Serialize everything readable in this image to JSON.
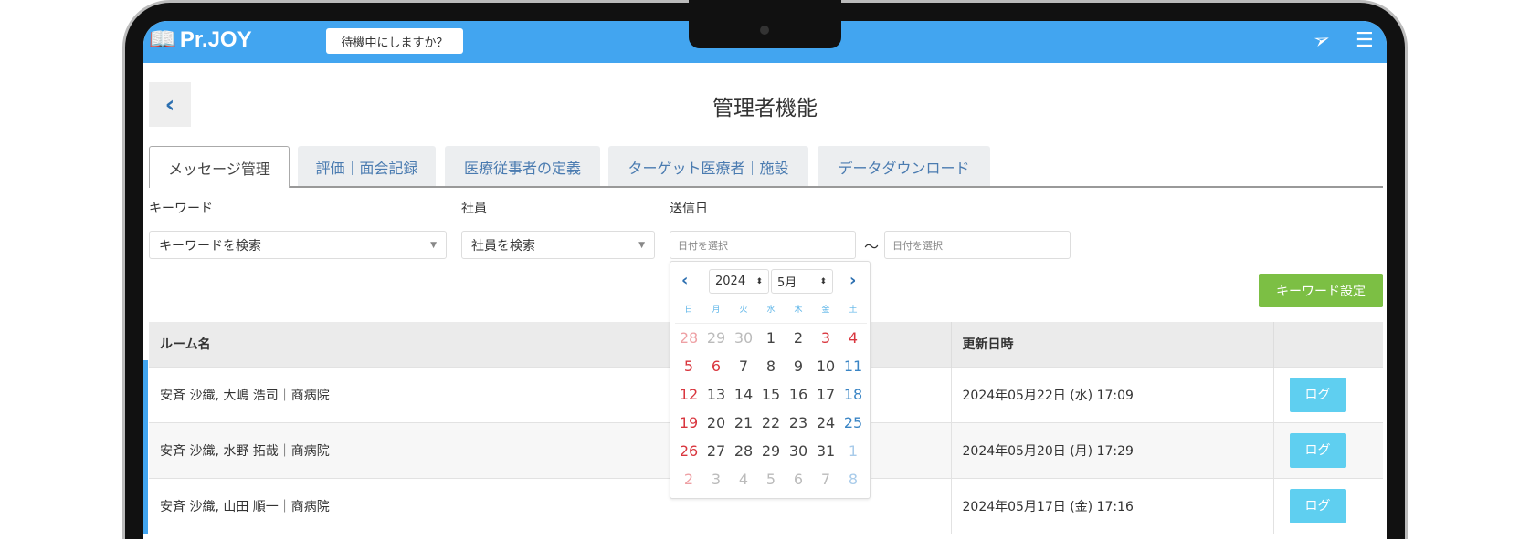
{
  "header": {
    "logo": "Pr.JOY",
    "standby_button": "待機中にしますか？",
    "icons": [
      "send-icon",
      "menu-icon"
    ]
  },
  "page": {
    "title": "管理者機能",
    "back": "back-chevron-icon"
  },
  "tabs": [
    {
      "label": "メッセージ管理",
      "active": true
    },
    {
      "label": "評価｜面会記録"
    },
    {
      "label": "医療従事者の定義"
    },
    {
      "label": "ターゲット医療者｜施設"
    },
    {
      "label": "データダウンロード"
    }
  ],
  "filters": {
    "keyword_label": "キーワード",
    "keyword_placeholder": "キーワードを検索",
    "employee_label": "社員",
    "employee_placeholder": "社員を検索",
    "date_label": "送信日",
    "date_from_placeholder": "日付を選択",
    "tilde": "〜",
    "date_to_placeholder": "日付を選択"
  },
  "keyword_settings_button": "キーワード設定",
  "calendar": {
    "year": "2024",
    "month": "5月",
    "weekdays": [
      "日",
      "月",
      "火",
      "水",
      "木",
      "金",
      "土"
    ],
    "weeks": [
      [
        "28",
        "29",
        "30",
        "1",
        "2",
        "3",
        "4"
      ],
      [
        "5",
        "6",
        "7",
        "8",
        "9",
        "10",
        "11"
      ],
      [
        "12",
        "13",
        "14",
        "15",
        "16",
        "17",
        "18"
      ],
      [
        "19",
        "20",
        "21",
        "22",
        "23",
        "24",
        "25"
      ],
      [
        "26",
        "27",
        "28",
        "29",
        "30",
        "31",
        "1"
      ],
      [
        "2",
        "3",
        "4",
        "5",
        "6",
        "7",
        "8"
      ]
    ],
    "holidays_in_month": [
      "3",
      "4",
      "5",
      "6"
    ]
  },
  "table": {
    "headers": [
      "ルーム名",
      "更新日時",
      ""
    ],
    "rows": [
      {
        "room": "安斉 沙織, 大嶋 浩司｜商病院",
        "updated": "2024年05月22日 (水) 17:09",
        "action": "ログ"
      },
      {
        "room": "安斉 沙織, 水野 拓哉｜商病院",
        "updated": "2024年05月20日 (月) 17:29",
        "action": "ログ"
      },
      {
        "room": "安斉 沙織, 山田 順一｜商病院",
        "updated": "2024年05月17日 (金) 17:16",
        "action": "ログ"
      }
    ]
  }
}
